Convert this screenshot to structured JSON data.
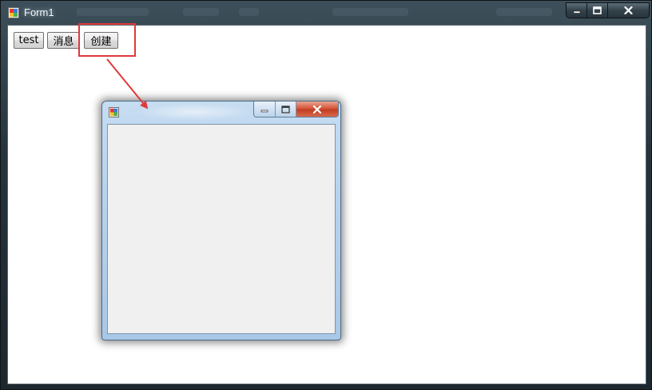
{
  "window": {
    "title": "Form1",
    "icon": "winforms-app-icon",
    "caption_buttons": [
      "minimize-icon",
      "maximize-icon",
      "close-icon"
    ]
  },
  "toolbar": {
    "test_label": "test",
    "message_label": "消息",
    "create_label": "创建"
  },
  "child_window": {
    "icon": "winforms-app-icon",
    "caption_buttons": [
      "minimize-icon",
      "maximize-icon",
      "close-icon"
    ]
  },
  "annotation": {
    "highlight_color": "#e0393b",
    "arrow_color": "#e0393b"
  },
  "colors": {
    "child_frame": "#b7d2ec",
    "child_close": "#c23d22",
    "client_bg": "#f0f0f0"
  }
}
